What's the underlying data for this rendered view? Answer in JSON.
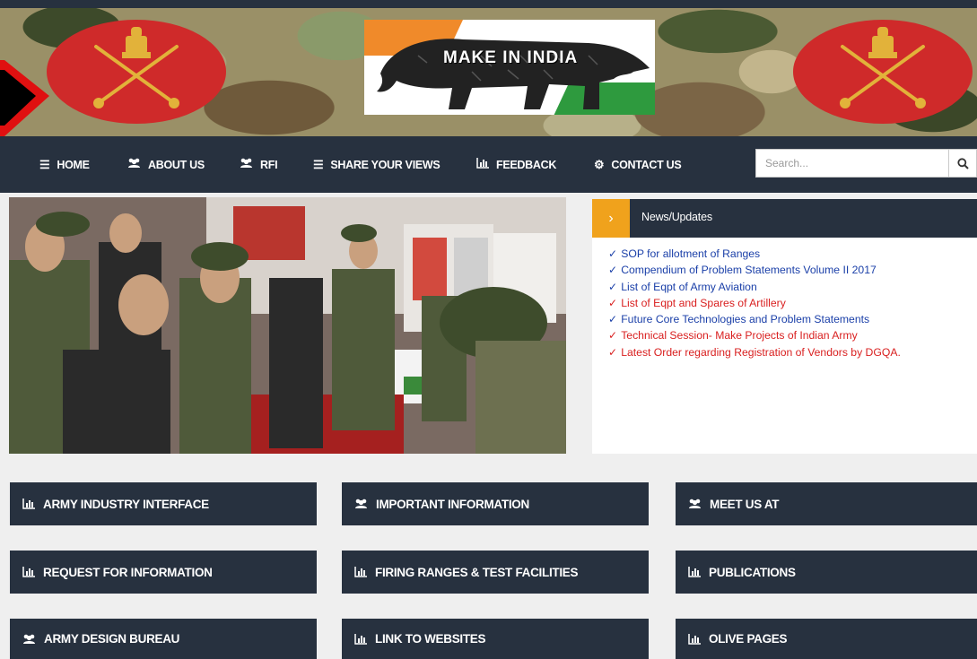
{
  "header": {
    "logo_text": "MAKE IN INDIA"
  },
  "nav": {
    "items": [
      {
        "label": "HOME",
        "icon": "bars-icon"
      },
      {
        "label": "ABOUT US",
        "icon": "users-icon"
      },
      {
        "label": "RFI",
        "icon": "users-icon"
      },
      {
        "label": "SHARE YOUR VIEWS",
        "icon": "bars-icon"
      },
      {
        "label": "FEEDBACK",
        "icon": "bar-chart-icon"
      },
      {
        "label": "CONTACT US",
        "icon": "gear-icon"
      }
    ],
    "search": {
      "placeholder": "Search...",
      "value": ""
    }
  },
  "news": {
    "title": "News/Updates",
    "items": [
      {
        "text": "SOP for allotment of Ranges",
        "color": "#1a3fa8"
      },
      {
        "text": "Compendium of Problem Statements Volume II 2017",
        "color": "#1a3fa8"
      },
      {
        "text": "List of Eqpt of Army Aviation",
        "color": "#1a3fa8"
      },
      {
        "text": "List of Eqpt and Spares of Artillery",
        "color": "#d92020"
      },
      {
        "text": "Future Core Technologies and Problem Statements",
        "color": "#1a3fa8"
      },
      {
        "text": "Technical Session- Make Projects of Indian Army",
        "color": "#d92020"
      },
      {
        "text": "Latest Order regarding Registration of Vendors by DGQA.",
        "color": "#d92020"
      }
    ]
  },
  "tiles": [
    {
      "label": "ARMY INDUSTRY INTERFACE",
      "icon": "bar-chart-icon"
    },
    {
      "label": "IMPORTANT INFORMATION",
      "icon": "users-icon"
    },
    {
      "label": "MEET US AT",
      "icon": "users-icon"
    },
    {
      "label": "REQUEST FOR INFORMATION",
      "icon": "bar-chart-icon"
    },
    {
      "label": "FIRING RANGES & TEST FACILITIES",
      "icon": "bar-chart-icon"
    },
    {
      "label": "PUBLICATIONS",
      "icon": "bar-chart-icon"
    },
    {
      "label": "ARMY DESIGN BUREAU",
      "icon": "users-icon"
    },
    {
      "label": "LINK TO WEBSITES",
      "icon": "bar-chart-icon"
    },
    {
      "label": "OLIVE PAGES",
      "icon": "bar-chart-icon"
    }
  ],
  "colors": {
    "navy": "#27313f",
    "accent_orange": "#f0a21c",
    "emblem_red": "#cf2a2a",
    "link_blue": "#1a3fa8",
    "link_red": "#d92020"
  }
}
